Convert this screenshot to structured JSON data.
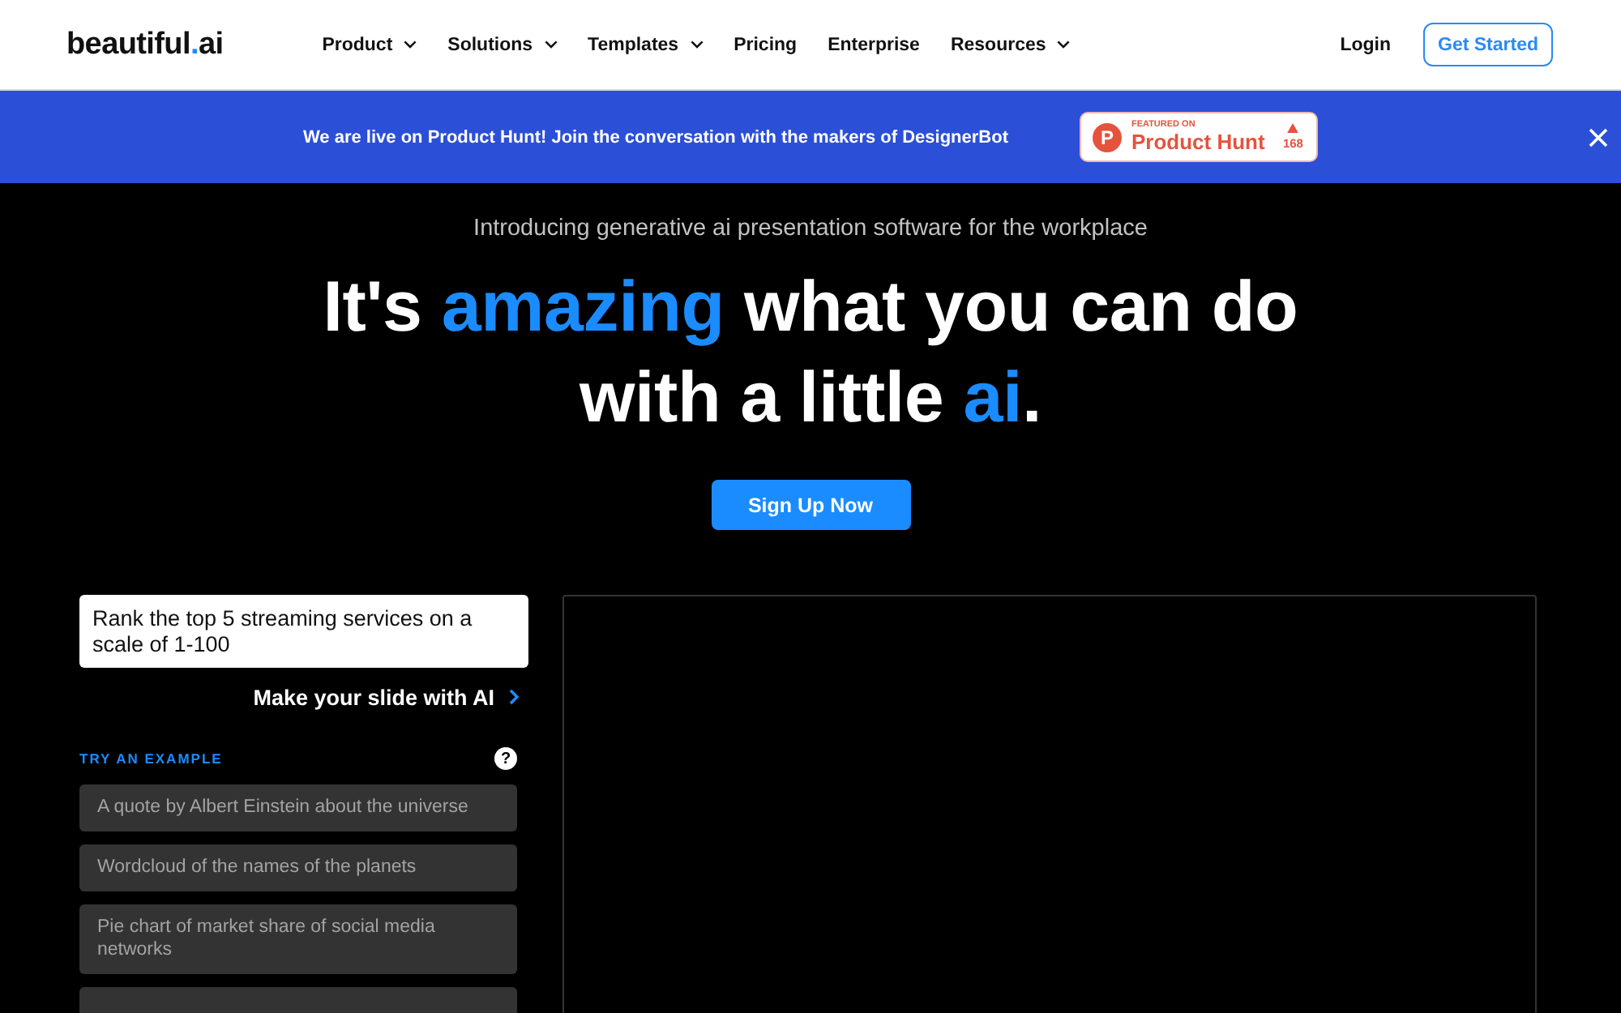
{
  "nav": {
    "logo": {
      "name": "beautiful",
      "dot": ".",
      "suffix": "ai"
    },
    "items": [
      {
        "label": "Product",
        "has_menu": true
      },
      {
        "label": "Solutions",
        "has_menu": true
      },
      {
        "label": "Templates",
        "has_menu": true
      },
      {
        "label": "Pricing",
        "has_menu": false
      },
      {
        "label": "Enterprise",
        "has_menu": false
      },
      {
        "label": "Resources",
        "has_menu": true
      }
    ],
    "login": "Login",
    "cta": "Get Started"
  },
  "banner": {
    "message": "We are live on Product Hunt! Join the conversation with the makers of DesignerBot",
    "badge": {
      "icon_letter": "P",
      "featured_label": "FEATURED ON",
      "name": "Product Hunt",
      "votes": "168"
    }
  },
  "hero": {
    "subtitle": "Introducing generative ai presentation software for the workplace",
    "headline": [
      [
        {
          "text": "It's ",
          "highlight": false
        },
        {
          "text": "amazing",
          "highlight": true
        },
        {
          "text": " what you can do",
          "highlight": false
        }
      ],
      [
        {
          "text": "with a little ",
          "highlight": false
        },
        {
          "text": "ai",
          "highlight": true
        },
        {
          "text": ".",
          "highlight": false
        }
      ]
    ],
    "signup_button": "Sign Up Now"
  },
  "generator": {
    "prompt": {
      "value": "Rank the top 5 streaming services on a scale of 1-100"
    },
    "submit": "Make your slide with AI",
    "examples_heading": "TRY AN EXAMPLE",
    "help_icon": "?",
    "examples": [
      {
        "text": "A quote by Albert Einstein about the universe"
      },
      {
        "text": "Wordcloud of the names of the planets"
      },
      {
        "text": "Pie chart of market share of social media networks"
      }
    ],
    "partly_hidden_example": true
  }
}
